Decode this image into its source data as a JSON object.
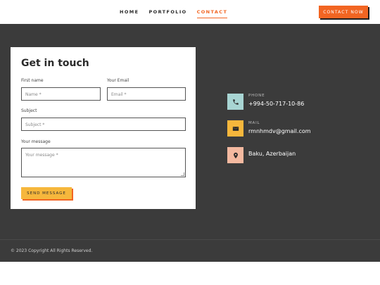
{
  "nav": {
    "items": [
      {
        "label": "HOME"
      },
      {
        "label": "PORTFOLIO"
      },
      {
        "label": "CONTACT"
      }
    ],
    "cta_label": "CONTACT NOW"
  },
  "form": {
    "title": "Get in touch",
    "first_name_label": "First name",
    "first_name_placeholder": "Name *",
    "email_label": "Your Email",
    "email_placeholder": "Email *",
    "subject_label": "Subject",
    "subject_placeholder": "Subject *",
    "message_label": "Your message",
    "message_placeholder": "Your message *",
    "submit_label": "SEND MESSAGE"
  },
  "contact": {
    "phone_label": "PHONE",
    "phone_value": "+994-50-717-10-86",
    "mail_label": "MAIL",
    "mail_value": "rmnhmdv@gmail.com",
    "location_value": "Baku, Azerbaijan"
  },
  "footer": {
    "copyright": "© 2023 Copyright All Rights Reserved."
  },
  "colors": {
    "accent": "#f26522",
    "button_yellow": "#f6b73c",
    "dark_bg": "#3b3b3b",
    "phone_icon_bg": "#a8d5d3",
    "mail_icon_bg": "#f6b73c",
    "location_icon_bg": "#f4b9a0"
  },
  "icons": {
    "phone": "phone-icon",
    "mail": "envelope-icon",
    "location": "map-pin-icon"
  }
}
